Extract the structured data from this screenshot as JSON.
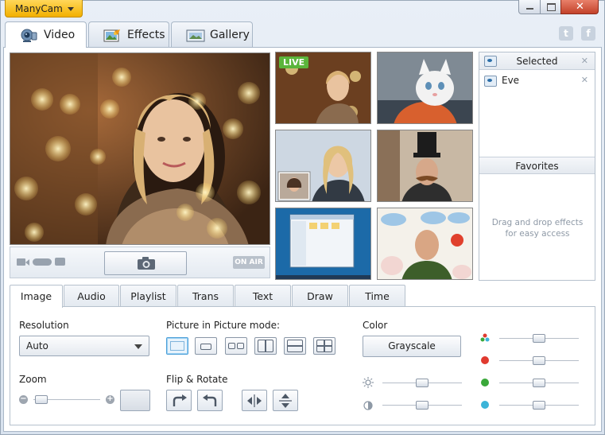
{
  "app": {
    "menu_label": "ManyCam"
  },
  "main_tabs": [
    {
      "label": "Video",
      "icon": "webcam-icon"
    },
    {
      "label": "Effects",
      "icon": "effects-icon"
    },
    {
      "label": "Gallery",
      "icon": "gallery-icon"
    }
  ],
  "social": {
    "twitter": "t",
    "facebook": "f"
  },
  "preview": {
    "on_air_label": "ON AIR",
    "live_label": "LIVE"
  },
  "side_panel": {
    "selected_header": "Selected",
    "selected_items": [
      "Eve"
    ],
    "favorites_header": "Favorites",
    "favorites_hint": "Drag and drop effects for easy access"
  },
  "sub_tabs": [
    "Image",
    "Audio",
    "Playlist",
    "Trans",
    "Text",
    "Draw",
    "Time"
  ],
  "image_settings": {
    "resolution_label": "Resolution",
    "resolution_value": "Auto",
    "pip_label": "Picture in Picture mode:",
    "color_label": "Color",
    "grayscale_label": "Grayscale",
    "zoom_label": "Zoom",
    "flip_label": "Flip & Rotate"
  },
  "colors": {
    "accent": "#f2b000",
    "red": "#e03a2f",
    "green": "#3aa83a",
    "cyan": "#3cb4d8"
  }
}
